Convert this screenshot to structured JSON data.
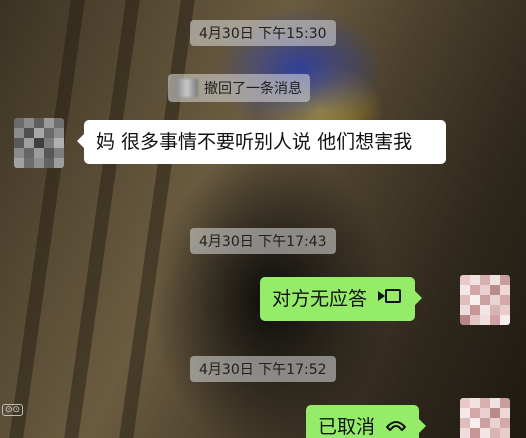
{
  "messages": {
    "time_1": "4月30日 下午15:30",
    "recall_text": "撤回了一条消息",
    "incoming_text": "妈 很多事情不要听别人说 他们想害我",
    "time_2": "4月30日 下午17:43",
    "outgoing_1_text": "对方无应答",
    "outgoing_1_icon": "video-call-icon",
    "time_3": "4月30日 下午17:52",
    "outgoing_2_text": "已取消",
    "outgoing_2_icon": "phone-icon"
  },
  "colors": {
    "sent_bubble": "#95ec69",
    "received_bubble": "#ffffff"
  }
}
